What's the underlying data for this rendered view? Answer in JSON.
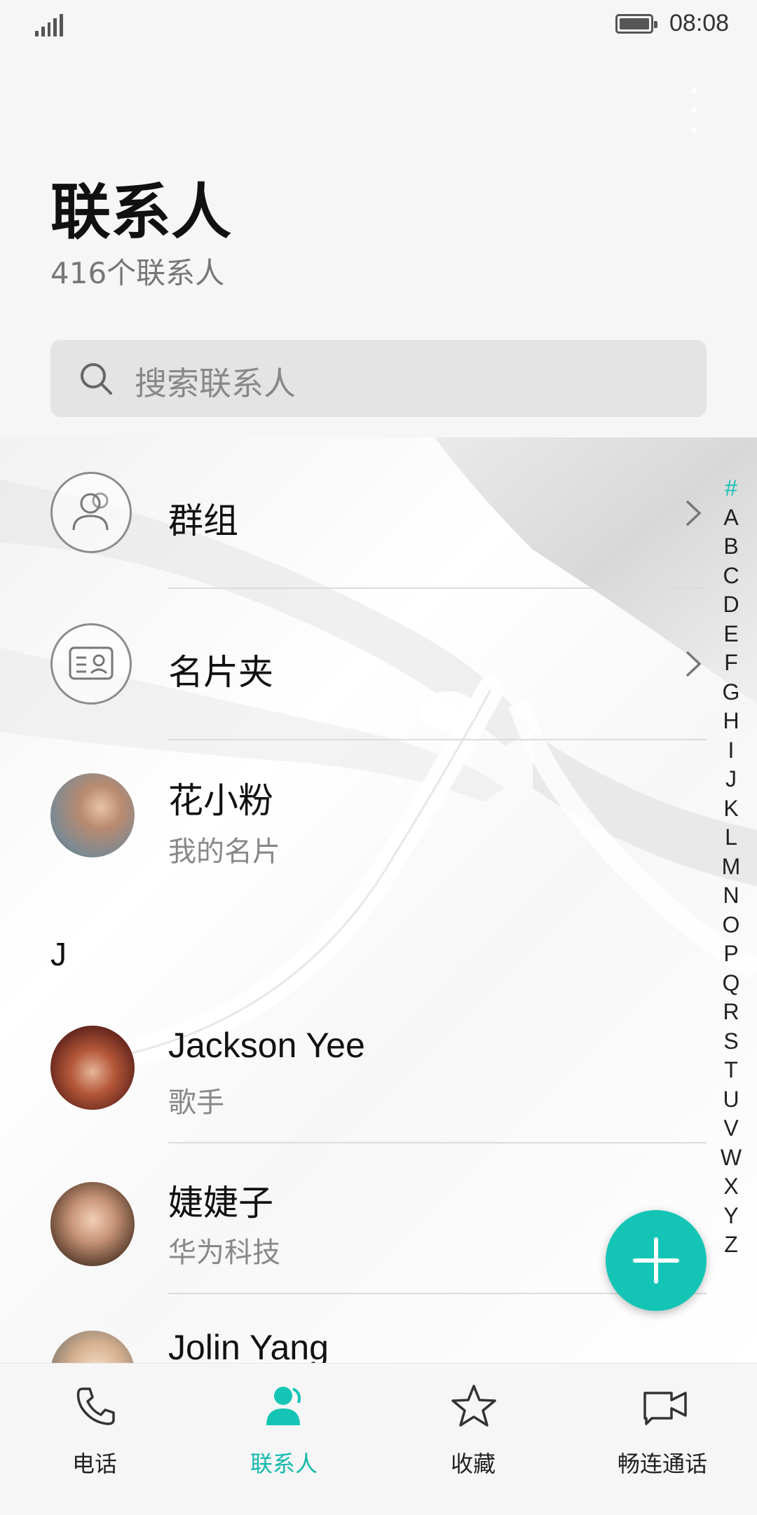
{
  "status_bar": {
    "time": "08:08"
  },
  "header": {
    "title": "联系人",
    "count_text": "416个联系人"
  },
  "search": {
    "placeholder": "搜索联系人"
  },
  "rows": {
    "groups": {
      "label": "群组"
    },
    "cards": {
      "label": "名片夹"
    },
    "my_card": {
      "name": "花小粉",
      "subtitle": "我的名片"
    }
  },
  "section_letter": "J",
  "contacts": [
    {
      "name": "Jackson Yee",
      "subtitle": "歌手"
    },
    {
      "name": "婕婕子",
      "subtitle": "华为科技"
    },
    {
      "name": "Jolin Yang",
      "subtitle": ""
    }
  ],
  "alphabet": [
    "#",
    "A",
    "B",
    "C",
    "D",
    "E",
    "F",
    "G",
    "H",
    "I",
    "J",
    "K",
    "L",
    "M",
    "N",
    "O",
    "P",
    "Q",
    "R",
    "S",
    "T",
    "U",
    "V",
    "W",
    "X",
    "Y",
    "Z"
  ],
  "alphabet_active": "#",
  "nav": [
    {
      "label": "电话",
      "icon": "phone-icon"
    },
    {
      "label": "联系人",
      "icon": "contacts-icon",
      "active": true
    },
    {
      "label": "收藏",
      "icon": "star-icon"
    },
    {
      "label": "畅连通话",
      "icon": "video-call-icon"
    }
  ],
  "colors": {
    "accent": "#14c5b6",
    "background": "#f6f6f6"
  }
}
